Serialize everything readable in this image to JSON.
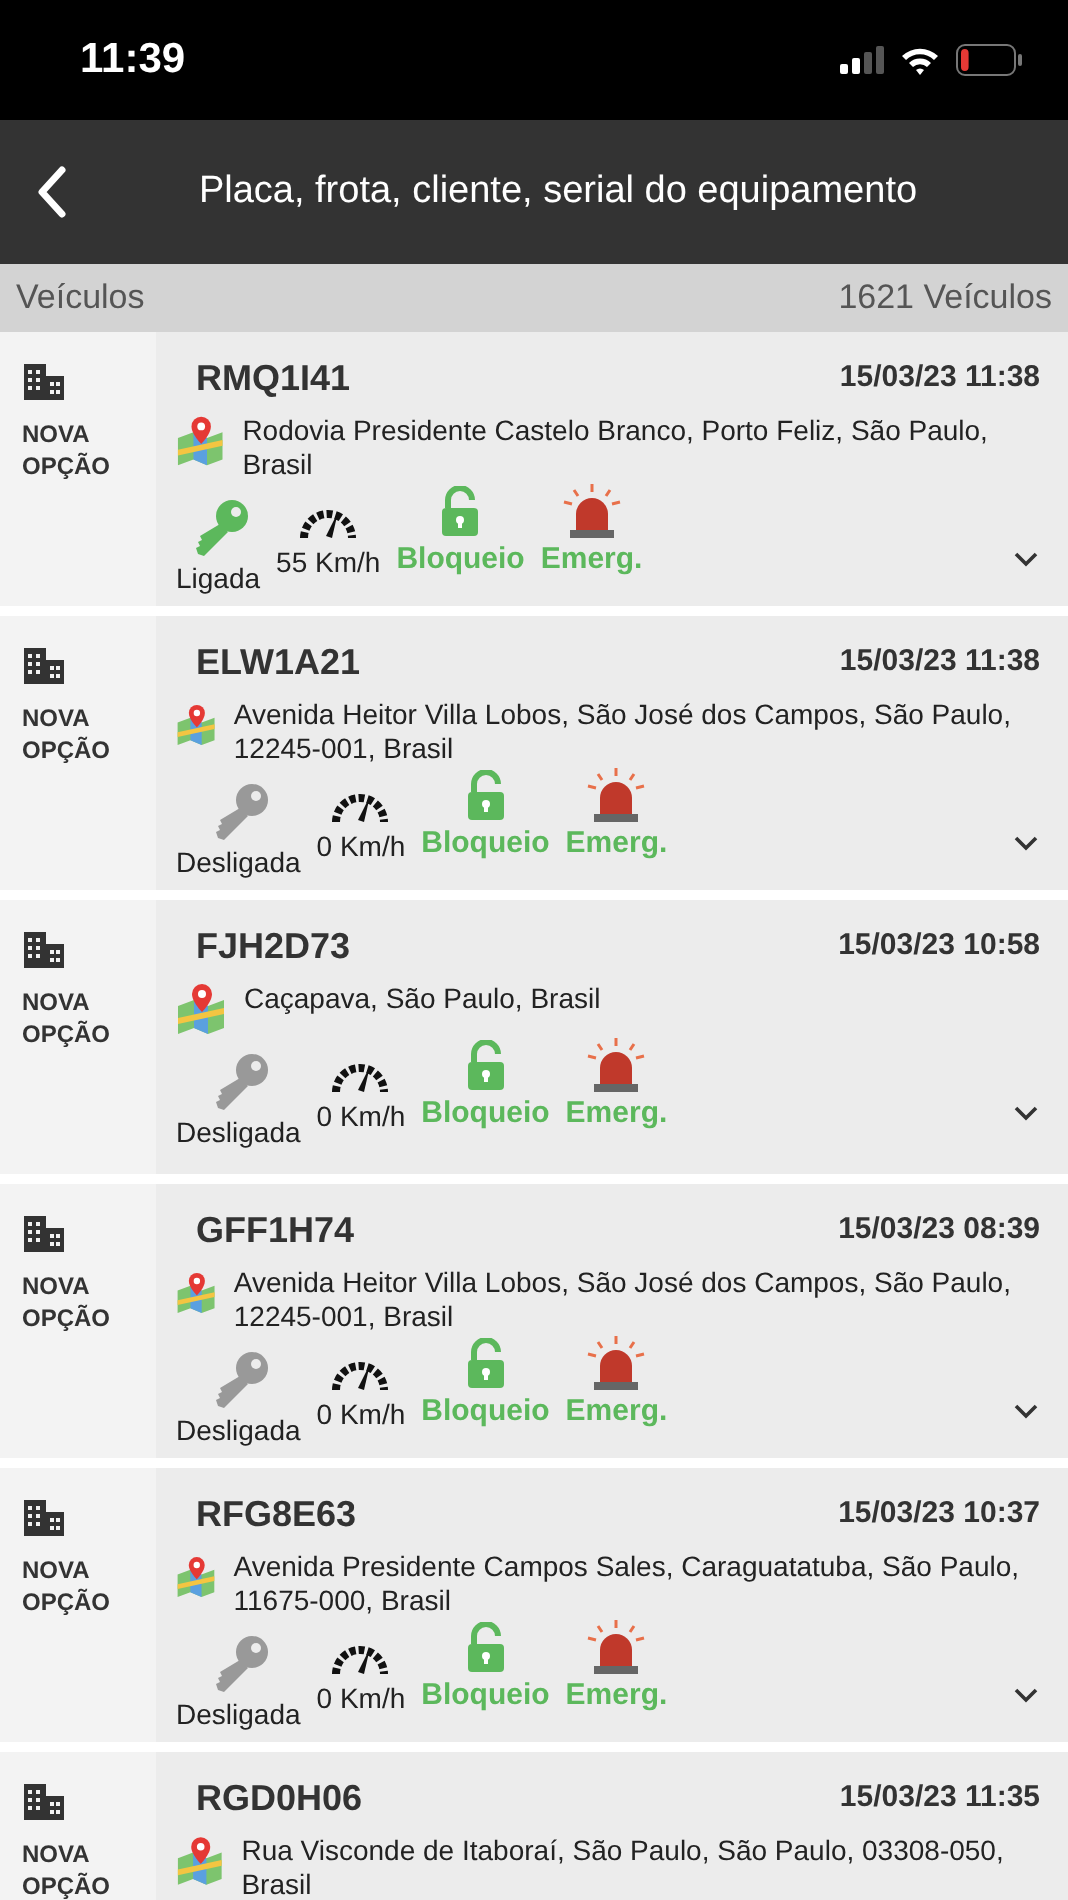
{
  "status_bar": {
    "time": "11:39"
  },
  "header": {
    "title": "Placa, frota, cliente, serial do equipamento"
  },
  "list_header": {
    "label": "Veículos",
    "count": "1621 Veículos"
  },
  "vehicles": [
    {
      "group": "NOVA OPÇÃO",
      "plate": "RMQ1I41",
      "datetime": "15/03/23 11:38",
      "address": "Rodovia Presidente Castelo Branco, Porto Feliz, São Paulo, Brasil",
      "ignition": {
        "label": "Ligada",
        "on": true
      },
      "speed": "55 Km/h",
      "block": "Bloqueio",
      "emergency": "Emerg."
    },
    {
      "group": "NOVA OPÇÃO",
      "plate": "ELW1A21",
      "datetime": "15/03/23 11:38",
      "address": "Avenida Heitor Villa Lobos, São José dos Campos, São Paulo, 12245-001, Brasil",
      "ignition": {
        "label": "Desligada",
        "on": false
      },
      "speed": "0 Km/h",
      "block": "Bloqueio",
      "emergency": "Emerg."
    },
    {
      "group": "NOVA OPÇÃO",
      "plate": "FJH2D73",
      "datetime": "15/03/23 10:58",
      "address": "Caçapava, São Paulo, Brasil",
      "ignition": {
        "label": "Desligada",
        "on": false
      },
      "speed": "0 Km/h",
      "block": "Bloqueio",
      "emergency": "Emerg."
    },
    {
      "group": "NOVA OPÇÃO",
      "plate": "GFF1H74",
      "datetime": "15/03/23 08:39",
      "address": "Avenida Heitor Villa Lobos, São José dos Campos, São Paulo, 12245-001, Brasil",
      "ignition": {
        "label": "Desligada",
        "on": false
      },
      "speed": "0 Km/h",
      "block": "Bloqueio",
      "emergency": "Emerg."
    },
    {
      "group": "NOVA OPÇÃO",
      "plate": "RFG8E63",
      "datetime": "15/03/23 10:37",
      "address": "Avenida Presidente Campos Sales, Caraguatatuba, São Paulo, 11675-000, Brasil",
      "ignition": {
        "label": "Desligada",
        "on": false
      },
      "speed": "0 Km/h",
      "block": "Bloqueio",
      "emergency": "Emerg."
    },
    {
      "group": "NOVA OPÇÃO",
      "plate": "RGD0H06",
      "datetime": "15/03/23 11:35",
      "address": "Rua Visconde de Itaboraí, São Paulo, São Paulo, 03308-050, Brasil"
    }
  ]
}
